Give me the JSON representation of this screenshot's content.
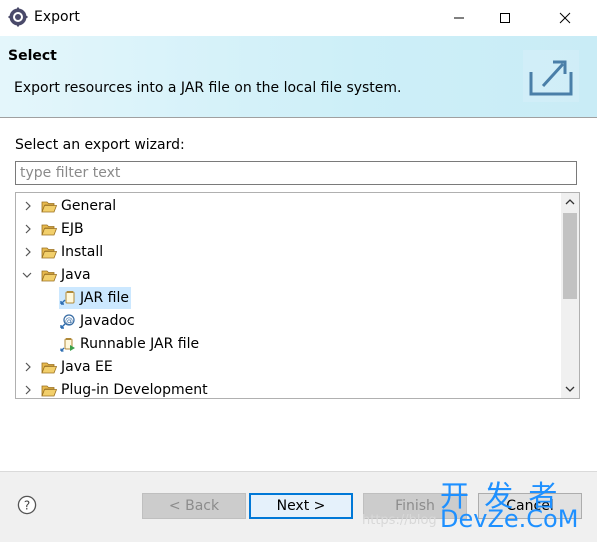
{
  "window": {
    "title": "Export",
    "icon": "eclipse-gear-icon",
    "controls": [
      "minimize-icon",
      "maximize-icon",
      "close-icon"
    ]
  },
  "banner": {
    "title": "Select",
    "description": "Export resources into a JAR file on the local file system.",
    "icon": "export-wizard-icon"
  },
  "wizard": {
    "label": "Select an export wizard:",
    "filter_placeholder": "type filter text",
    "filter_value": ""
  },
  "tree": {
    "items": [
      {
        "label": "General",
        "level": 0,
        "expanded": false,
        "icon": "folder-icon"
      },
      {
        "label": "EJB",
        "level": 0,
        "expanded": false,
        "icon": "folder-icon"
      },
      {
        "label": "Install",
        "level": 0,
        "expanded": false,
        "icon": "folder-icon"
      },
      {
        "label": "Java",
        "level": 0,
        "expanded": true,
        "icon": "folder-icon"
      },
      {
        "label": "JAR file",
        "level": 1,
        "selected": true,
        "icon": "jar-file-icon"
      },
      {
        "label": "Javadoc",
        "level": 1,
        "icon": "javadoc-icon"
      },
      {
        "label": "Runnable JAR file",
        "level": 1,
        "icon": "runnable-jar-icon"
      },
      {
        "label": "Java EE",
        "level": 0,
        "expanded": false,
        "icon": "folder-icon"
      },
      {
        "label": "Plug-in Development",
        "level": 0,
        "expanded": false,
        "icon": "folder-icon"
      }
    ]
  },
  "footer": {
    "help_icon": "help-icon",
    "back_label": "< Back",
    "next_label": "Next >",
    "finish_label": "Finish",
    "cancel_label": "Cancel"
  },
  "watermark": {
    "top": "开 发 者",
    "bottom": "DevZe.CoM",
    "url": "https://blog"
  },
  "colors": {
    "banner_bg": "#cdeff8",
    "selection": "#cce8ff",
    "primary_border": "#0078d7",
    "watermark": "#1e90ff"
  }
}
